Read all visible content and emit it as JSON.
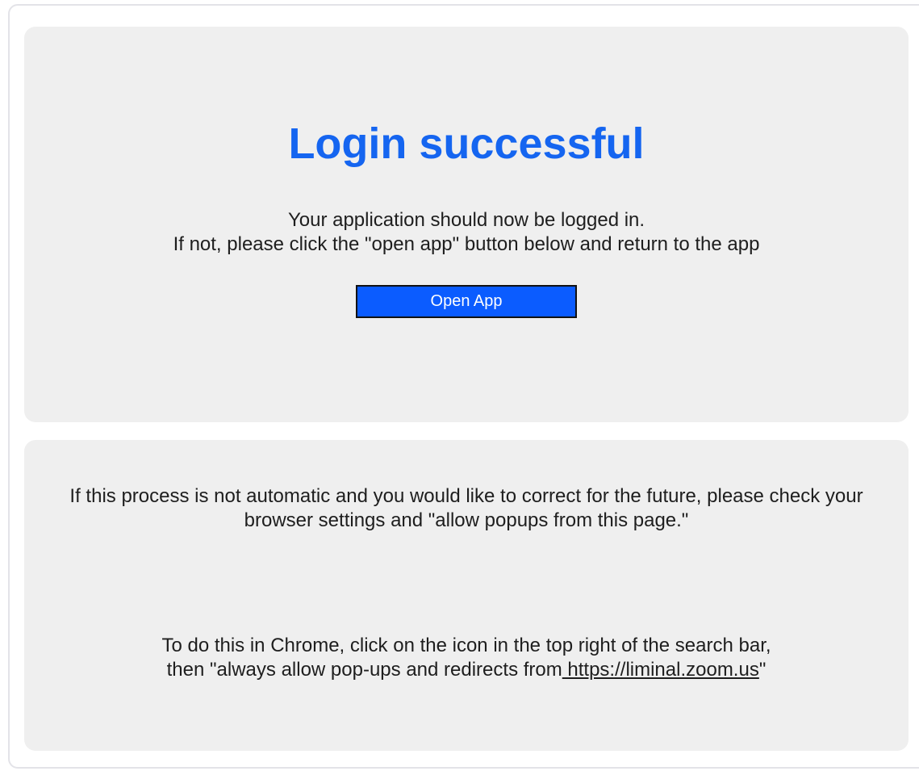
{
  "main_panel": {
    "title": "Login successful",
    "message_line1": "Your application should now be logged in.",
    "message_line2": "If not, please click the \"open app\" button below and return to the app",
    "open_app_button": "Open App"
  },
  "help_panel": {
    "popup_text": "If this process is not automatic and you would like to correct for the future, please check your browser settings and \"allow popups from this page.\"",
    "chrome_line1": "To do this in Chrome, click on the icon in the top right of the search bar,",
    "chrome_line2_prefix": "then \"always allow pop-ups and redirects from",
    "chrome_link": " https://liminal.zoom.us",
    "chrome_line2_suffix": "\""
  },
  "colors": {
    "title": "#1565f0",
    "button": "#0b5cff",
    "panel_bg": "#efefef"
  }
}
